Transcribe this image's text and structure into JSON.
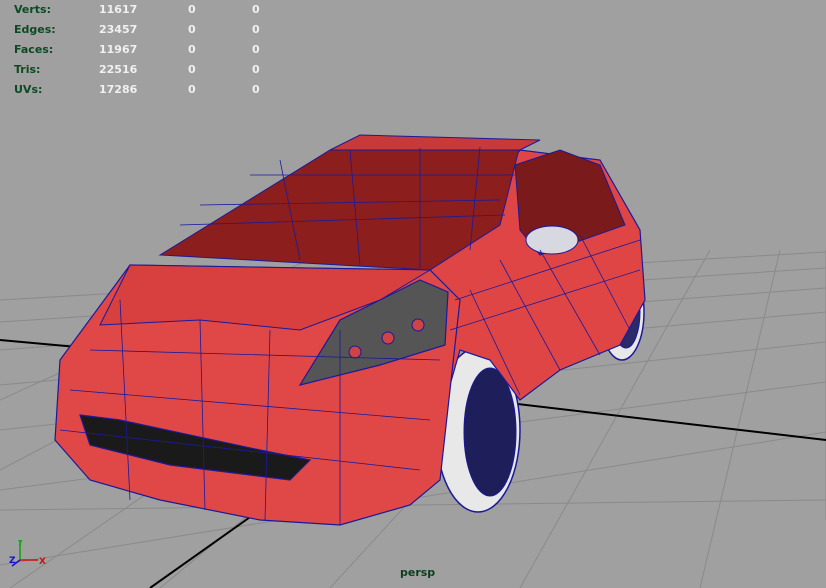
{
  "hud": {
    "rows": [
      {
        "label": "Verts:",
        "total": "11617",
        "selected": "0",
        "component": "0"
      },
      {
        "label": "Edges:",
        "total": "23457",
        "selected": "0",
        "component": "0"
      },
      {
        "label": "Faces:",
        "total": "11967",
        "selected": "0",
        "component": "0"
      },
      {
        "label": "Tris:",
        "total": "22516",
        "selected": "0",
        "component": "0"
      },
      {
        "label": "UVs:",
        "total": "17286",
        "selected": "0",
        "component": "0"
      }
    ]
  },
  "viewport": {
    "camera": "persp",
    "axis_labels": {
      "x": "X",
      "y": "Y",
      "z": "Z"
    }
  },
  "colors": {
    "background": "#a0a0a0",
    "grid": "#8a8a8a",
    "grid_axis": "#000000",
    "hud_label": "#0c4a23",
    "hud_value": "#f0f0f0",
    "car_body": "#e04545",
    "car_wire": "#1a1a9a",
    "glass": "#8c1e1e",
    "tire": "#e8e8e8"
  },
  "icons": {
    "axis": "axis-gizmo-icon"
  }
}
